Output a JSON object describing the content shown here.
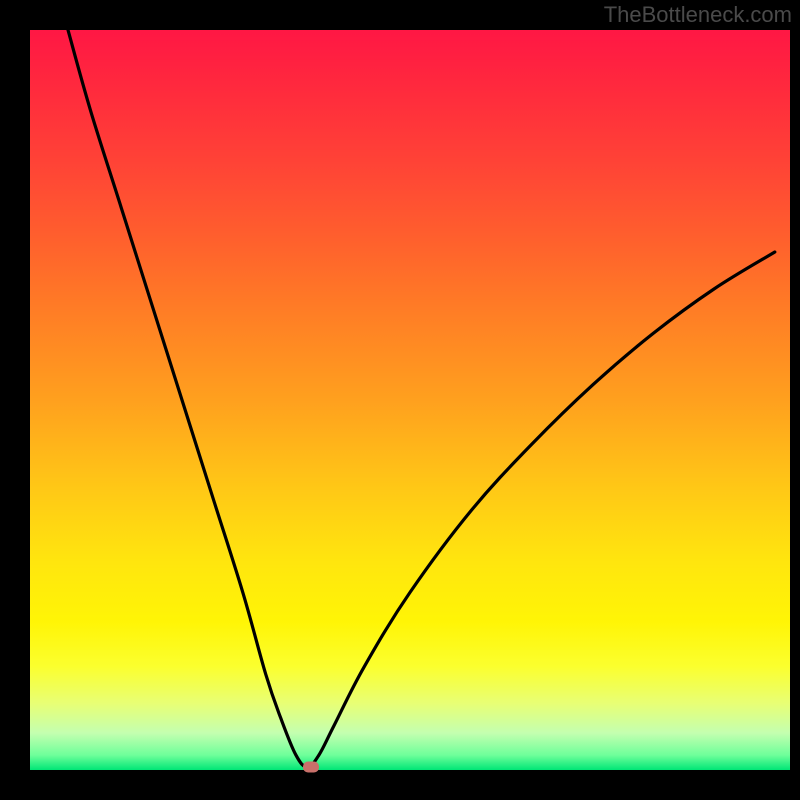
{
  "watermark": "TheBottleneck.com",
  "chart_data": {
    "type": "line",
    "title": "",
    "xlabel": "",
    "ylabel": "",
    "xlim": [
      0,
      100
    ],
    "ylim": [
      0,
      100
    ],
    "series": [
      {
        "name": "bottleneck-curve",
        "x": [
          5,
          8,
          12,
          16,
          20,
          24,
          28,
          31,
          33,
          35,
          36.5,
          38,
          40,
          44,
          50,
          58,
          66,
          74,
          82,
          90,
          98
        ],
        "y": [
          100,
          89,
          76,
          63,
          50,
          37,
          24,
          13,
          7,
          2,
          0.4,
          2,
          6,
          14,
          24,
          35,
          44,
          52,
          59,
          65,
          70
        ]
      }
    ],
    "annotations": [
      {
        "type": "marker",
        "x": 37,
        "y": 0.2,
        "name": "optimum"
      }
    ],
    "gradient": {
      "top": "#ff1744",
      "mid": "#ffe60e",
      "bottom": "#00e676"
    }
  },
  "marker": {
    "left_pct": 37,
    "top_pct": 99.6
  }
}
